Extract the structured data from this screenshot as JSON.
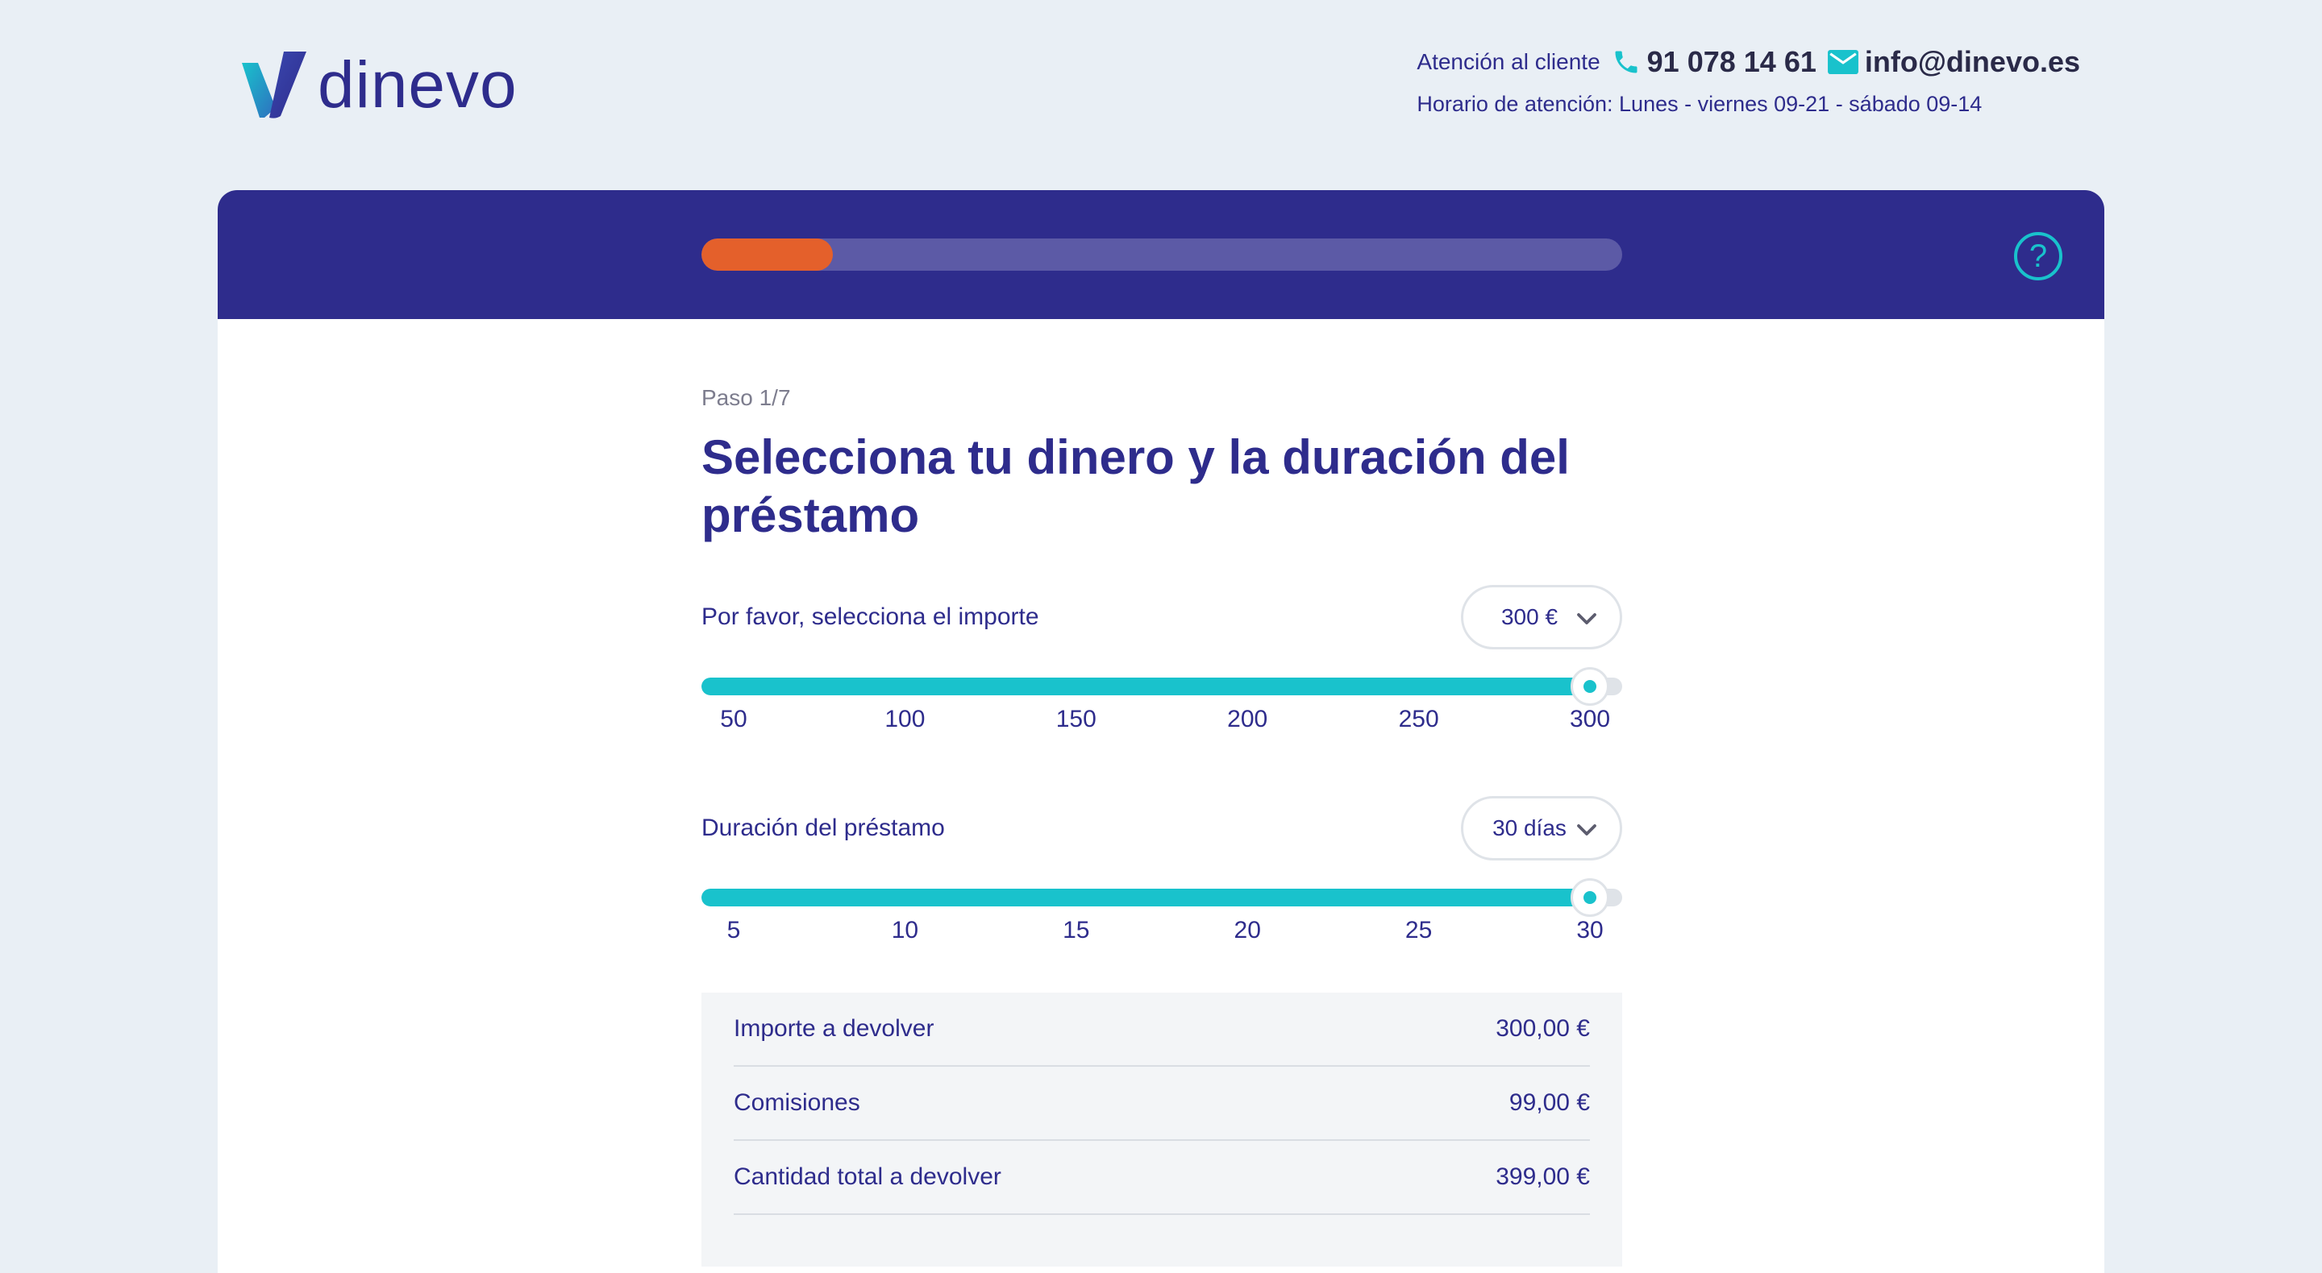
{
  "brand": {
    "name": "dinevo"
  },
  "contact": {
    "label": "Atención al cliente",
    "phone": "91 078 14 61",
    "email": "info@dinevo.es",
    "hours": "Horario de atención: Lunes - viernes 09-21 - sábado 09-14"
  },
  "progress": {
    "fraction": 0.143
  },
  "step": {
    "label": "Paso 1/7"
  },
  "title": "Selecciona tu dinero y la duración del préstamo",
  "amount": {
    "label": "Por favor, selecciona el importe",
    "selected": "300 €",
    "value": 300,
    "min": 50,
    "max": 300,
    "ticks": [
      "50",
      "100",
      "150",
      "200",
      "250",
      "300"
    ]
  },
  "duration": {
    "label": "Duración del préstamo",
    "selected": "30 días",
    "value": 30,
    "min": 5,
    "max": 30,
    "ticks": [
      "5",
      "10",
      "15",
      "20",
      "25",
      "30"
    ]
  },
  "summary": [
    {
      "label": "Importe a devolver",
      "value": "300,00 €"
    },
    {
      "label": "Comisiones",
      "value": "99,00 €"
    },
    {
      "label": "Cantidad total a devolver",
      "value": "399,00 €"
    }
  ],
  "colors": {
    "primary": "#2e2c8c",
    "accent": "#19c2cc",
    "progress": "#e4602b",
    "background": "#e9eff5"
  },
  "icons": {
    "logo": "dinevo-v-logo-icon",
    "phone": "phone-icon",
    "email": "mail-icon",
    "help": "help-icon",
    "chevron": "chevron-down-icon"
  }
}
